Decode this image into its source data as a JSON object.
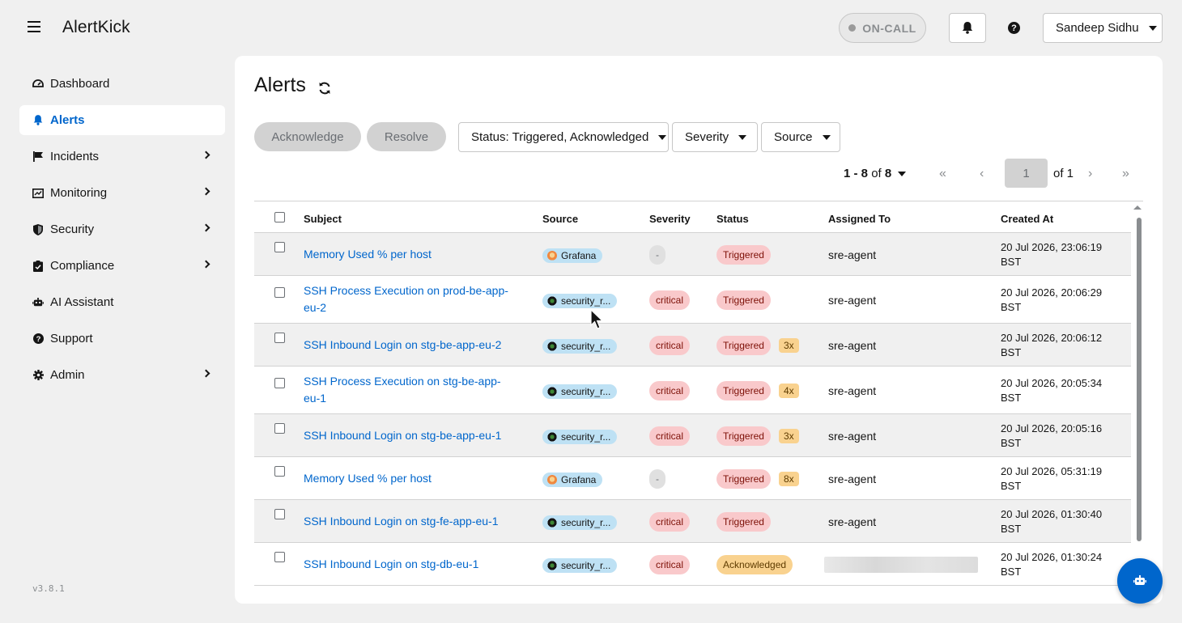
{
  "header": {
    "brand": "AlertKick",
    "oncall_label": "ON-CALL",
    "user_name": "Sandeep Sidhu"
  },
  "sidebar": {
    "items": [
      {
        "label": "Dashboard",
        "icon": "dashboard-icon",
        "active": false,
        "expandable": false
      },
      {
        "label": "Alerts",
        "icon": "bell-icon",
        "active": true,
        "expandable": false
      },
      {
        "label": "Incidents",
        "icon": "flag-icon",
        "active": false,
        "expandable": true
      },
      {
        "label": "Monitoring",
        "icon": "monitoring-icon",
        "active": false,
        "expandable": true
      },
      {
        "label": "Security",
        "icon": "shield-icon",
        "active": false,
        "expandable": true
      },
      {
        "label": "Compliance",
        "icon": "clipboard-check-icon",
        "active": false,
        "expandable": true
      },
      {
        "label": "AI Assistant",
        "icon": "robot-icon",
        "active": false,
        "expandable": false
      },
      {
        "label": "Support",
        "icon": "help-circle-icon",
        "active": false,
        "expandable": false
      },
      {
        "label": "Admin",
        "icon": "gear-icon",
        "active": false,
        "expandable": true
      }
    ],
    "version": "v3.8.1"
  },
  "main": {
    "title": "Alerts",
    "actions": {
      "acknowledge": "Acknowledge",
      "resolve": "Resolve"
    },
    "filters": {
      "status": "Status: Triggered, Acknowledged",
      "severity": "Severity",
      "source": "Source"
    },
    "pagination": {
      "range": "1 - 8",
      "of_word": "of",
      "total": "8",
      "page_value": "1",
      "of_pages": "of 1"
    },
    "table": {
      "columns": {
        "subject": "Subject",
        "source": "Source",
        "severity": "Severity",
        "status": "Status",
        "assigned": "Assigned To",
        "created": "Created At"
      },
      "rows": [
        {
          "subject": [
            "Memory Used % per host"
          ],
          "source": "Grafana",
          "source_type": "grafana",
          "severity": "-",
          "status": "Triggered",
          "count": "",
          "assigned": "sre-agent",
          "created": [
            "20 Jul 2026, 23:06:19",
            "BST"
          ]
        },
        {
          "subject": [
            "SSH Process Execution on prod-be-app-",
            "eu-2"
          ],
          "source": "security_r...",
          "source_type": "security",
          "severity": "critical",
          "status": "Triggered",
          "count": "",
          "assigned": "sre-agent",
          "created": [
            "20 Jul 2026, 20:06:29",
            "BST"
          ]
        },
        {
          "subject": [
            "SSH Inbound Login on stg-be-app-eu-2"
          ],
          "source": "security_r...",
          "source_type": "security",
          "severity": "critical",
          "status": "Triggered",
          "count": "3x",
          "assigned": "sre-agent",
          "created": [
            "20 Jul 2026, 20:06:12",
            "BST"
          ]
        },
        {
          "subject": [
            "SSH Process Execution on stg-be-app-",
            "eu-1"
          ],
          "source": "security_r...",
          "source_type": "security",
          "severity": "critical",
          "status": "Triggered",
          "count": "4x",
          "assigned": "sre-agent",
          "created": [
            "20 Jul 2026, 20:05:34",
            "BST"
          ]
        },
        {
          "subject": [
            "SSH Inbound Login on stg-be-app-eu-1"
          ],
          "source": "security_r...",
          "source_type": "security",
          "severity": "critical",
          "status": "Triggered",
          "count": "3x",
          "assigned": "sre-agent",
          "created": [
            "20 Jul 2026, 20:05:16",
            "BST"
          ]
        },
        {
          "subject": [
            "Memory Used % per host"
          ],
          "source": "Grafana",
          "source_type": "grafana",
          "severity": "-",
          "status": "Triggered",
          "count": "8x",
          "assigned": "sre-agent",
          "created": [
            "20 Jul 2026, 05:31:19",
            "BST"
          ]
        },
        {
          "subject": [
            "SSH Inbound Login on stg-fe-app-eu-1"
          ],
          "source": "security_r...",
          "source_type": "security",
          "severity": "critical",
          "status": "Triggered",
          "count": "",
          "assigned": "sre-agent",
          "created": [
            "20 Jul 2026, 01:30:40",
            "BST"
          ]
        },
        {
          "subject": [
            "SSH Inbound Login on stg-db-eu-1"
          ],
          "source": "security_r...",
          "source_type": "security",
          "severity": "critical",
          "status": "Acknowledged",
          "count": "",
          "assigned": "",
          "created": [
            "20 Jul 2026, 01:30:24",
            "BST"
          ]
        }
      ]
    }
  },
  "colors": {
    "accent": "#0066cc",
    "critical_bg": "#f9c9cb",
    "acknowledged_bg": "#f9d28f",
    "source_bg": "#bee1f4"
  }
}
